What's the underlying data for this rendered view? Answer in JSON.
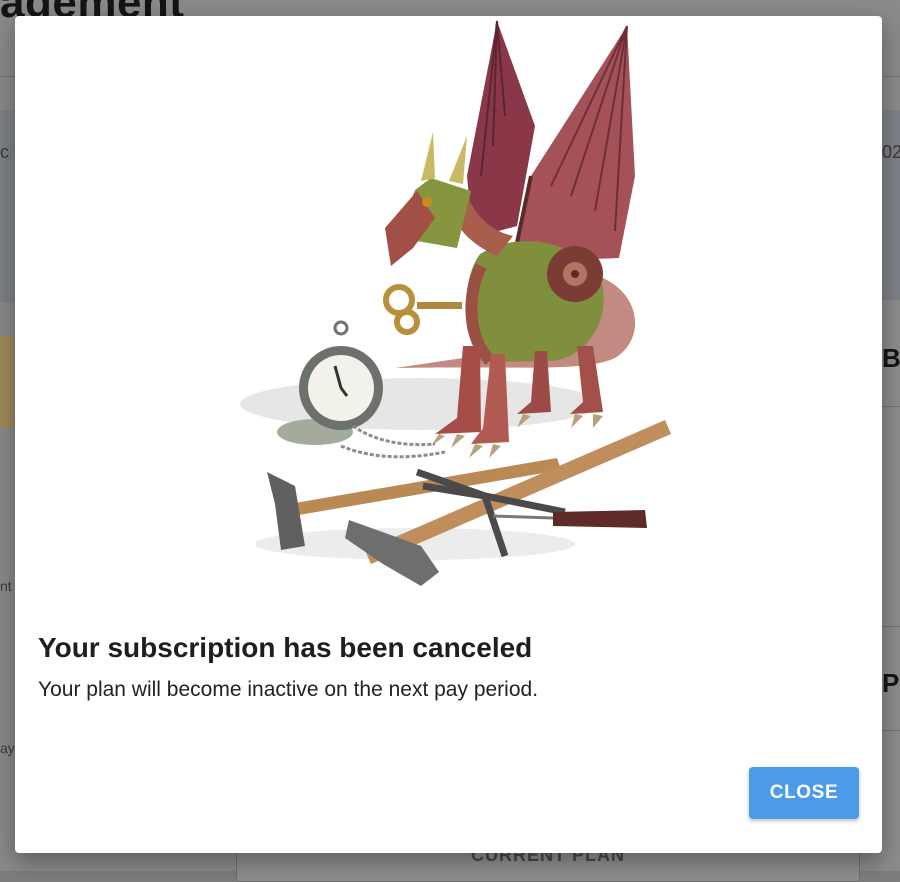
{
  "background": {
    "page_title": "agement",
    "fragment_left_1": "c",
    "fragment_right_1": "02",
    "fragment_left_2": "nt",
    "fragment_left_3": "ay",
    "fragment_right_b": "B",
    "fragment_right_p": "P",
    "current_plan_label": "CURRENT PLAN"
  },
  "modal": {
    "illustration": "clockwork-dragon-illustration",
    "title": "Your subscription has been canceled",
    "message": "Your plan will become inactive on the next pay period.",
    "close_label": "CLOSE",
    "accent_color": "#4c9be8"
  }
}
